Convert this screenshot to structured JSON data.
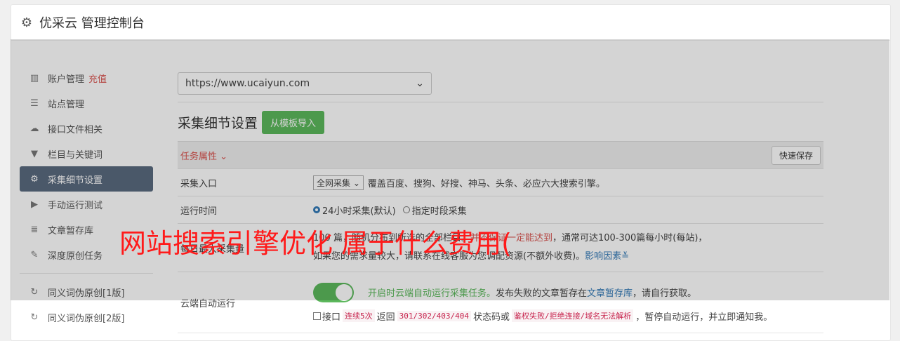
{
  "header": {
    "title": "优采云 管理控制台"
  },
  "sidebar": {
    "items": [
      {
        "label": "账户管理",
        "extra": "充值"
      },
      {
        "label": "站点管理"
      },
      {
        "label": "接口文件相关"
      },
      {
        "label": "栏目与关键词"
      },
      {
        "label": "采集细节设置"
      },
      {
        "label": "手动运行测试"
      },
      {
        "label": "文章暂存库"
      },
      {
        "label": "深度原创任务"
      },
      {
        "label": "同义词伪原创[1版]"
      },
      {
        "label": "同义词伪原创[2版]"
      }
    ]
  },
  "main": {
    "site_select": "https://www.ucaiyun.com",
    "section_title": "采集细节设置",
    "import_button": "从模板导入",
    "task_props": "任务属性",
    "quick_save": "快速保存",
    "rows": {
      "entry_label": "采集入口",
      "entry_select": "全网采集",
      "entry_desc": "覆盖百度、搜狗、好搜、神马、头条、必应六大搜索引擎。",
      "time_label": "运行时间",
      "time_opt1": "24小时采集(默认)",
      "time_opt2": "指定时段采集",
      "quota_label": "每日最大采集量",
      "quota_text1": "100 篇，随机分布到所选的全部栏目。",
      "quota_guarantee": "并不保证一定能达到",
      "quota_text2": "，通常可达100-300篇每小时(每站)，",
      "quota_text3": "如果您的需求量较大，请联系在线客服为您调配资源(不额外收费)。",
      "quota_link": "影响因素",
      "cloud_label": "云端自动运行",
      "cloud_green": "开启时云端自动运行采集任务。",
      "cloud_text": "发布失败的文章暂存在",
      "cloud_link": "文章暂存库",
      "cloud_text2": "，请自行获取。",
      "iface_text1": "接口",
      "iface_code1": "连续5次",
      "iface_text2": "返回",
      "iface_code2": "301/302/403/404",
      "iface_text3": "状态码或",
      "iface_code3": "鉴权失败/拒绝连接/域名无法解析",
      "iface_text4": "，暂停自动运行，并立即通知我。"
    }
  },
  "overlay_text": "网站搜索引擎优化 属于什么费用(",
  "colors": {
    "accent_green": "#5cb85c",
    "active_nav": "#5a6a7f",
    "watermark": "#ff1a1a"
  }
}
